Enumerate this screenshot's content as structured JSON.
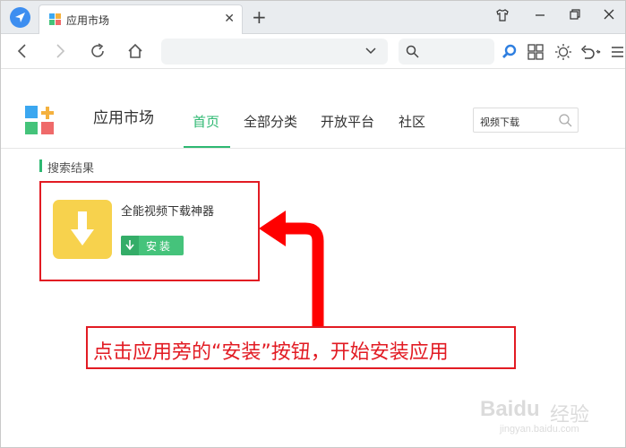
{
  "browser": {
    "tab_title": "应用市场",
    "tab_close": "✕",
    "new_tab": "+",
    "address_value": "",
    "search_value": ""
  },
  "site": {
    "name": "应用市场",
    "nav": [
      "首页",
      "全部分类",
      "开放平台",
      "社区"
    ],
    "active_nav": "首页",
    "search_value": "视频下载"
  },
  "results": {
    "title": "搜索结果",
    "items": [
      {
        "name": "全能视频下载神器",
        "install_label": "安装"
      }
    ]
  },
  "annotation": {
    "text": "点击应用旁的“安装”按钮，开始安装应用"
  },
  "watermark": {
    "brand": "Baidu",
    "cn": "经验",
    "url": "jingyan.baidu.com"
  },
  "colors": {
    "accent_green": "#2eb872",
    "install_green": "#45c37b",
    "annotation_red": "#e21b23",
    "app_icon_yellow": "#f7d24d",
    "browser_blue": "#3d8ef0"
  },
  "icons": {
    "browser": "browser-compass-icon",
    "back": "back-arrow-icon",
    "forward": "forward-arrow-icon",
    "reload": "reload-icon",
    "home": "home-icon",
    "dropdown": "chevron-down-icon",
    "search": "search-icon",
    "grid": "app-grid-icon",
    "theme": "sun-icon",
    "undo": "undo-icon",
    "menu": "menu-icon",
    "skin": "shirt-icon",
    "minimize": "minimize-icon",
    "restore": "restore-icon",
    "close": "close-icon",
    "download": "download-arrow-icon"
  }
}
